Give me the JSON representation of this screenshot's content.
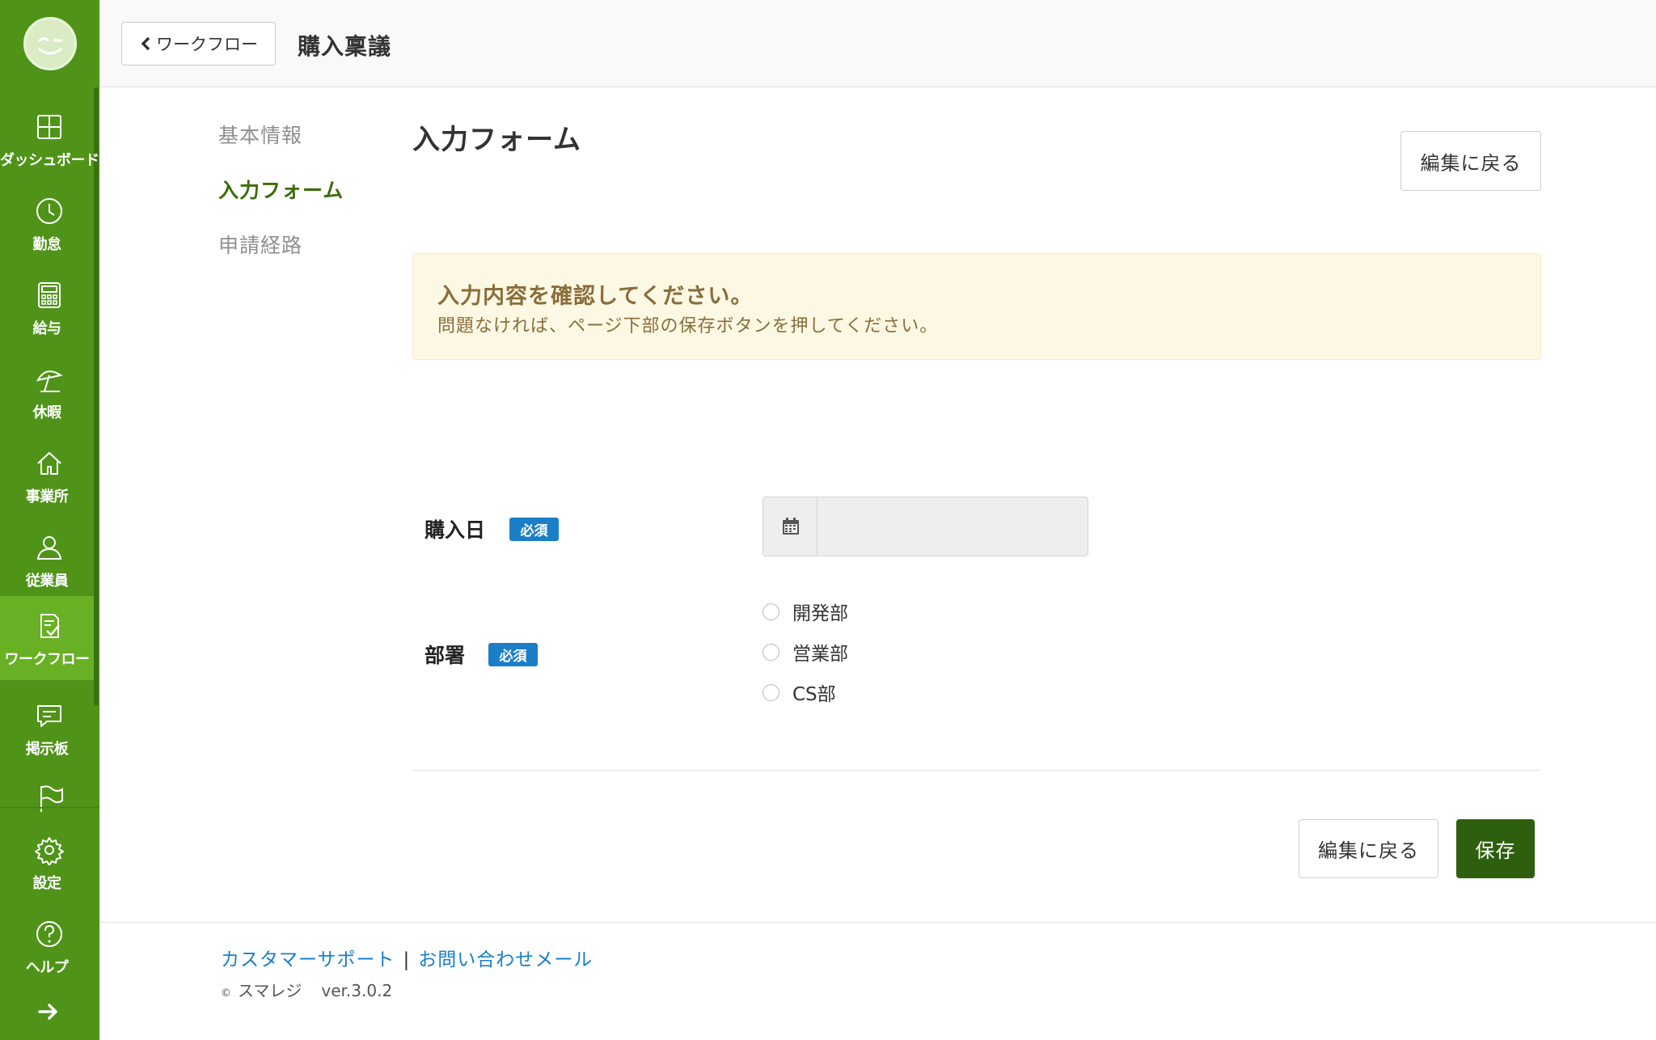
{
  "sidebar": {
    "items": [
      {
        "label": "ダッシュボード",
        "icon": "dashboard-icon"
      },
      {
        "label": "勤怠",
        "icon": "clock-icon"
      },
      {
        "label": "給与",
        "icon": "calculator-icon"
      },
      {
        "label": "休暇",
        "icon": "beach-umbrella-icon"
      },
      {
        "label": "事業所",
        "icon": "home-icon"
      },
      {
        "label": "従業員",
        "icon": "user-icon"
      },
      {
        "label": "ワークフロー",
        "icon": "workflow-icon",
        "active": true
      },
      {
        "label": "掲示板",
        "icon": "message-icon"
      },
      {
        "label": "設定",
        "icon": "gear-icon"
      },
      {
        "label": "ヘルプ",
        "icon": "help-icon"
      }
    ],
    "accent": "#4f9418",
    "active_color": "#68b024"
  },
  "header": {
    "back_label": "ワークフロー",
    "title": "購入稟議"
  },
  "steps": [
    {
      "label": "基本情報"
    },
    {
      "label": "入力フォーム",
      "current": true
    },
    {
      "label": "申請経路"
    }
  ],
  "main": {
    "title": "入力フォーム",
    "back_to_edit_label": "編集に戻る",
    "alert": {
      "title": "入力内容を確認してください。",
      "body": "問題なければ、ページ下部の保存ボタンを押してください。"
    },
    "fields": {
      "purchase_date": {
        "label": "購入日",
        "badge": "必須",
        "value": ""
      },
      "department": {
        "label": "部署",
        "badge": "必須",
        "options": [
          "開発部",
          "営業部",
          "CS部"
        ],
        "selected": null
      }
    },
    "footer_buttons": {
      "back_to_edit_label": "編集に戻る",
      "save_label": "保存"
    },
    "save_color": "#2e5f0e",
    "badge_color": "#1a7fc7"
  },
  "footer": {
    "support_link": "カスタマーサポート",
    "separator": "|",
    "contact_link": "お問い合わせメール",
    "copyright_symbol": "©",
    "brand": "スマレジ",
    "version": "ver.3.0.2"
  }
}
